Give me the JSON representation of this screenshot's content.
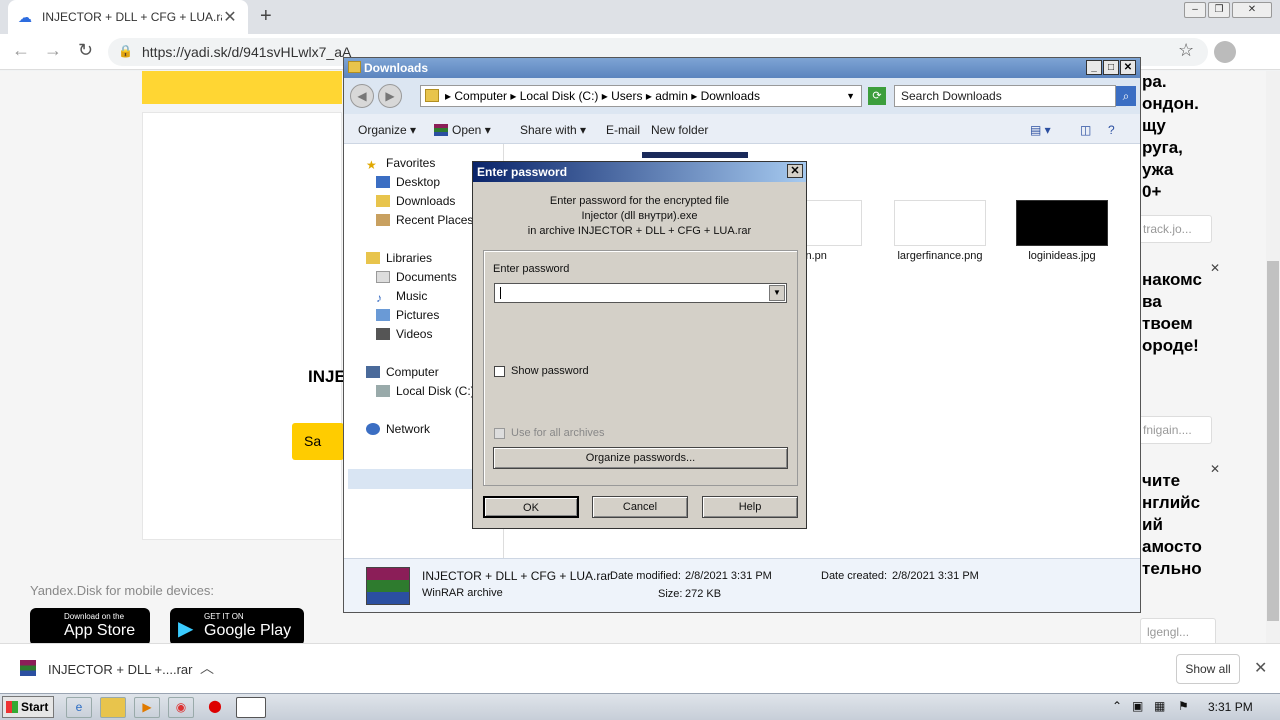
{
  "browser": {
    "tab_title": "INJECTOR + DLL + CFG + LUA.rar –",
    "url": "https://yadi.sk/d/941svHLwlx7_aA",
    "new_tab": "+",
    "close_tab": "✕"
  },
  "page": {
    "inje_text": "INJE",
    "save_button": "Sa",
    "mobile_text": "Yandex.Disk for mobile devices:",
    "app_store_small": "Download on the",
    "app_store_big": "App Store",
    "google_play_small": "GET IT ON",
    "google_play_big": "Google Play",
    "ad1_lines": [
      "ра.",
      "ондон.",
      "щу",
      "руга,",
      "ужа",
      "0+"
    ],
    "ad1_link": "track.jo...",
    "ad2_lines": [
      "накомс",
      "ва",
      " твоем",
      "ороде!"
    ],
    "ad2_link": "fnigain....",
    "ad3_lines": [
      "чите",
      "нглийс",
      "ий",
      "амосто",
      "тельно"
    ],
    "ad3_link": "lgengl..."
  },
  "explorer": {
    "title": "Downloads",
    "breadcrumb": [
      "Computer",
      "Local Disk (C:)",
      "Users",
      "admin",
      "Downloads"
    ],
    "search_placeholder": "Search Downloads",
    "commands": [
      "Organize",
      "Open",
      "Share with",
      "E-mail",
      "New folder"
    ],
    "nav": {
      "favorites": "Favorites",
      "desktop": "Desktop",
      "downloads": "Downloads",
      "recent": "Recent Places",
      "libraries": "Libraries",
      "documents": "Documents",
      "music": "Music",
      "pictures": "Pictures",
      "videos": "Videos",
      "computer": "Computer",
      "local_disk": "Local Disk (C:)",
      "network": "Network"
    },
    "files": {
      "f1_line1": "oduction.pn",
      "f1_line2": "g",
      "f2": "largerfinance.png",
      "f3": "loginideas.jpg"
    },
    "details": {
      "name": "INJECTOR + DLL + CFG + LUA.rar",
      "type": "WinRAR archive",
      "modified_label": "Date modified:",
      "modified": "2/8/2021 3:31 PM",
      "created_label": "Date created:",
      "created": "2/8/2021 3:31 PM",
      "size_label": "Size:",
      "size": "272 KB"
    }
  },
  "dialog": {
    "title": "Enter password",
    "info_line1": "Enter password for the encrypted file",
    "info_line2": "Injector (dll внутри).exe",
    "info_line3": "in archive INJECTOR + DLL + CFG + LUA.rar",
    "enter_label": "Enter password",
    "show_password": "Show password",
    "use_all": "Use for all archives",
    "organize": "Organize passwords...",
    "ok": "OK",
    "cancel": "Cancel",
    "help": "Help"
  },
  "download_bar": {
    "file": "INJECTOR + DLL +....rar",
    "show_all": "Show all"
  },
  "taskbar": {
    "start": "Start",
    "time": "3:31 PM"
  },
  "colors": {
    "yandex_yellow": "#ffcc00",
    "dialog_title": "#0a246a",
    "explorer_title": "#5b84be"
  }
}
